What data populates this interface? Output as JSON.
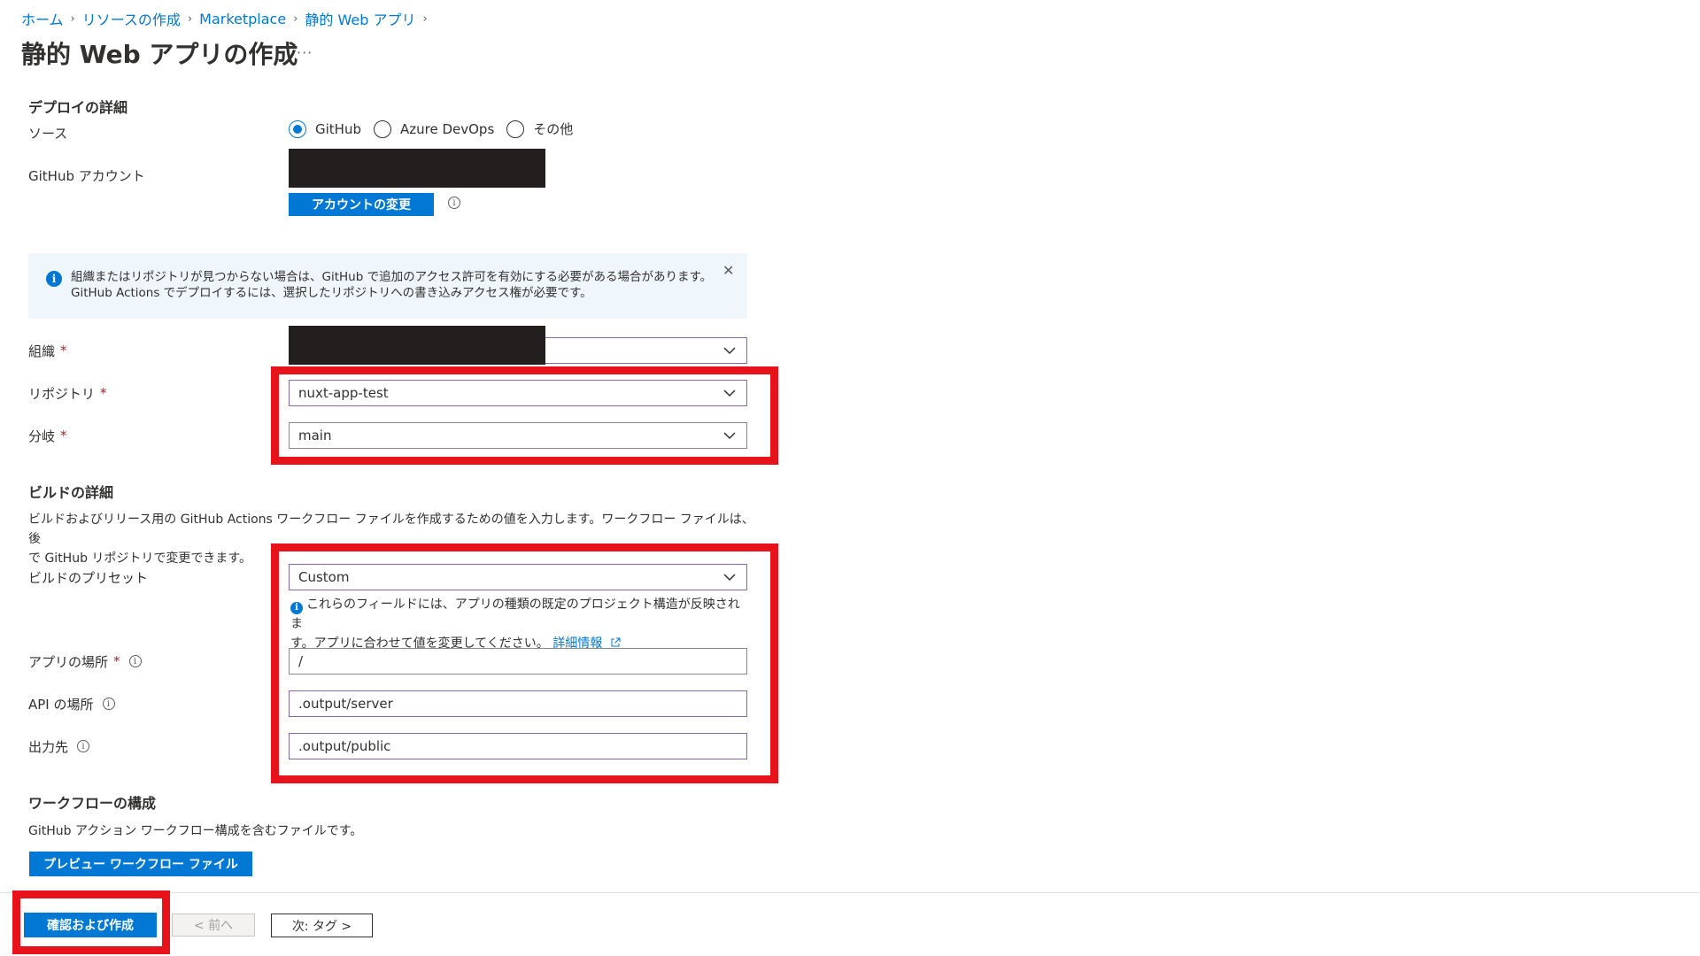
{
  "breadcrumb": [
    "ホーム",
    "リソースの作成",
    "Marketplace",
    "静的 Web アプリ"
  ],
  "page": {
    "title": "静的 Web アプリの作成",
    "more": "···"
  },
  "deploy": {
    "section_title": "デプロイの詳細",
    "source_label": "ソース",
    "source_options": [
      {
        "label": "GitHub",
        "selected": true
      },
      {
        "label": "Azure DevOps",
        "selected": false
      },
      {
        "label": "その他",
        "selected": false
      }
    ],
    "account_label": "GitHub アカウント",
    "change_account_button": "アカウントの変更"
  },
  "banner": {
    "line1": "組織またはリポジトリが見つからない場合は、GitHub で追加のアクセス許可を有効にする必要がある場合があります。",
    "line2": "GitHub Actions でデプロイするには、選択したリポジトリへの書き込みアクセス権が必要です。"
  },
  "fields": {
    "org_label": "組織",
    "repo_label": "リポジトリ",
    "repo_value": "nuxt-app-test",
    "branch_label": "分岐",
    "branch_value": "main"
  },
  "build": {
    "section_title": "ビルドの詳細",
    "description_line1": "ビルドおよびリリース用の GitHub Actions ワークフロー ファイルを作成するための値を入力します。ワークフロー ファイルは、後",
    "description_line2": "で GitHub リポジトリで変更できます。",
    "preset_label": "ビルドのプリセット",
    "preset_value": "Custom",
    "preset_help_line1": "これらのフィールドには、アプリの種類の既定のプロジェクト構造が反映されま",
    "preset_help_line2": "す。アプリに合わせて値を変更してください。",
    "preset_help_link": "詳細情報",
    "app_location_label": "アプリの場所",
    "app_location_value": "/",
    "api_location_label": "API の場所",
    "api_location_value": ".output/server",
    "output_label": "出力先",
    "output_value": ".output/public"
  },
  "workflow": {
    "section_title": "ワークフローの構成",
    "description": "GitHub アクション ワークフロー構成を含むファイルです。",
    "preview_button": "プレビュー ワークフロー ファイル"
  },
  "footer": {
    "create_button": "確認および作成",
    "prev_button": "< 前へ",
    "next_button": "次: タグ >"
  },
  "colors": {
    "accent": "#0078d4",
    "highlight": "#e8121b",
    "redaction": "#231f1f"
  }
}
